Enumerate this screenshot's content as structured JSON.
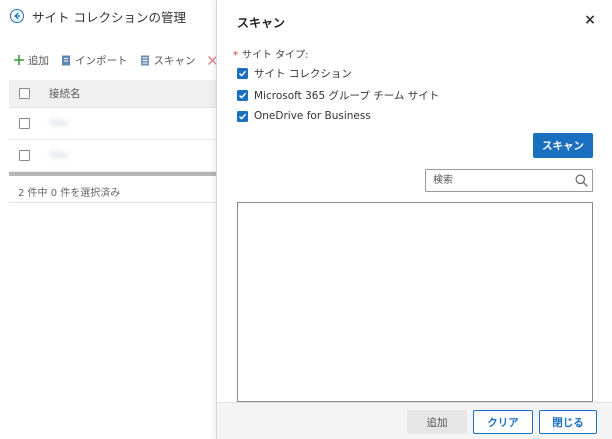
{
  "page": {
    "title": "サイト コレクションの管理",
    "toolbar": {
      "add": "追加",
      "import": "インポート",
      "scan": "スキャン",
      "delete": "削除"
    },
    "grid": {
      "header": "接続名",
      "rows": [
        {
          "name": "Site"
        },
        {
          "name": "Site"
        }
      ],
      "footer": "2 件中 0 件を選択済み"
    }
  },
  "dialog": {
    "title": "スキャン",
    "close_symbol": "×",
    "site_type_label": "サイト タイプ:",
    "required_mark": "*",
    "options": [
      {
        "label": "サイト コレクション",
        "checked": true
      },
      {
        "label": "Microsoft 365 グループ チーム サイト",
        "checked": true
      },
      {
        "label": "OneDrive for Business",
        "checked": true
      }
    ],
    "scan_button": "スキャン",
    "search": {
      "placeholder": "検索",
      "value": ""
    },
    "footer": {
      "add": "追加",
      "clear": "クリア",
      "close": "閉じる"
    }
  },
  "colors": {
    "accent": "#1a6fbf",
    "footer_bg": "#f4f4f4",
    "disabled_button": "#e6e6e6"
  }
}
